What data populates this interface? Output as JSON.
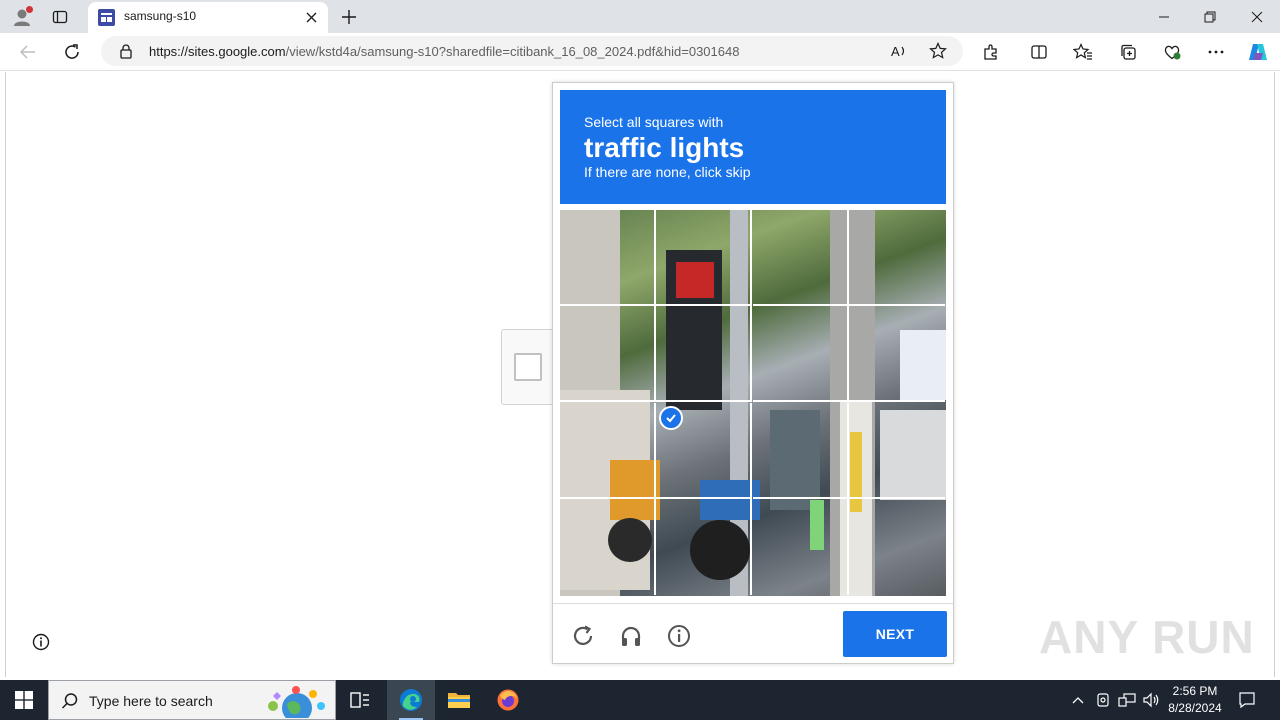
{
  "browser": {
    "tab_title": "samsung-s10",
    "url_host": "https://sites.google.com",
    "url_path": "/view/kstd4a/samsung-s10?sharedfile=citibank_16_08_2024.pdf&hid=0301648",
    "icons": [
      "profile-icon",
      "tab-actions-icon",
      "new-tab-icon",
      "minimize-icon",
      "restore-icon",
      "close-icon",
      "back-icon",
      "refresh-icon",
      "lock-icon",
      "read-aloud-icon",
      "favorite-icon",
      "extensions-icon",
      "split-screen-icon",
      "favorites-icon",
      "collections-icon",
      "browser-essentials-icon",
      "more-icon",
      "copilot-icon"
    ]
  },
  "captcha": {
    "prompt_line1": "Select all squares with",
    "prompt_target": "traffic lights",
    "prompt_line3": "If there are none, click skip",
    "grid_rows": 4,
    "grid_cols": 4,
    "selected_tile": "row 3, column 2",
    "next_label": "NEXT",
    "header_color": "#1a73e8"
  },
  "watermark": "ANY RUN",
  "taskbar": {
    "search_placeholder": "Type here to search",
    "time": "2:56 PM",
    "date": "8/28/2024"
  }
}
